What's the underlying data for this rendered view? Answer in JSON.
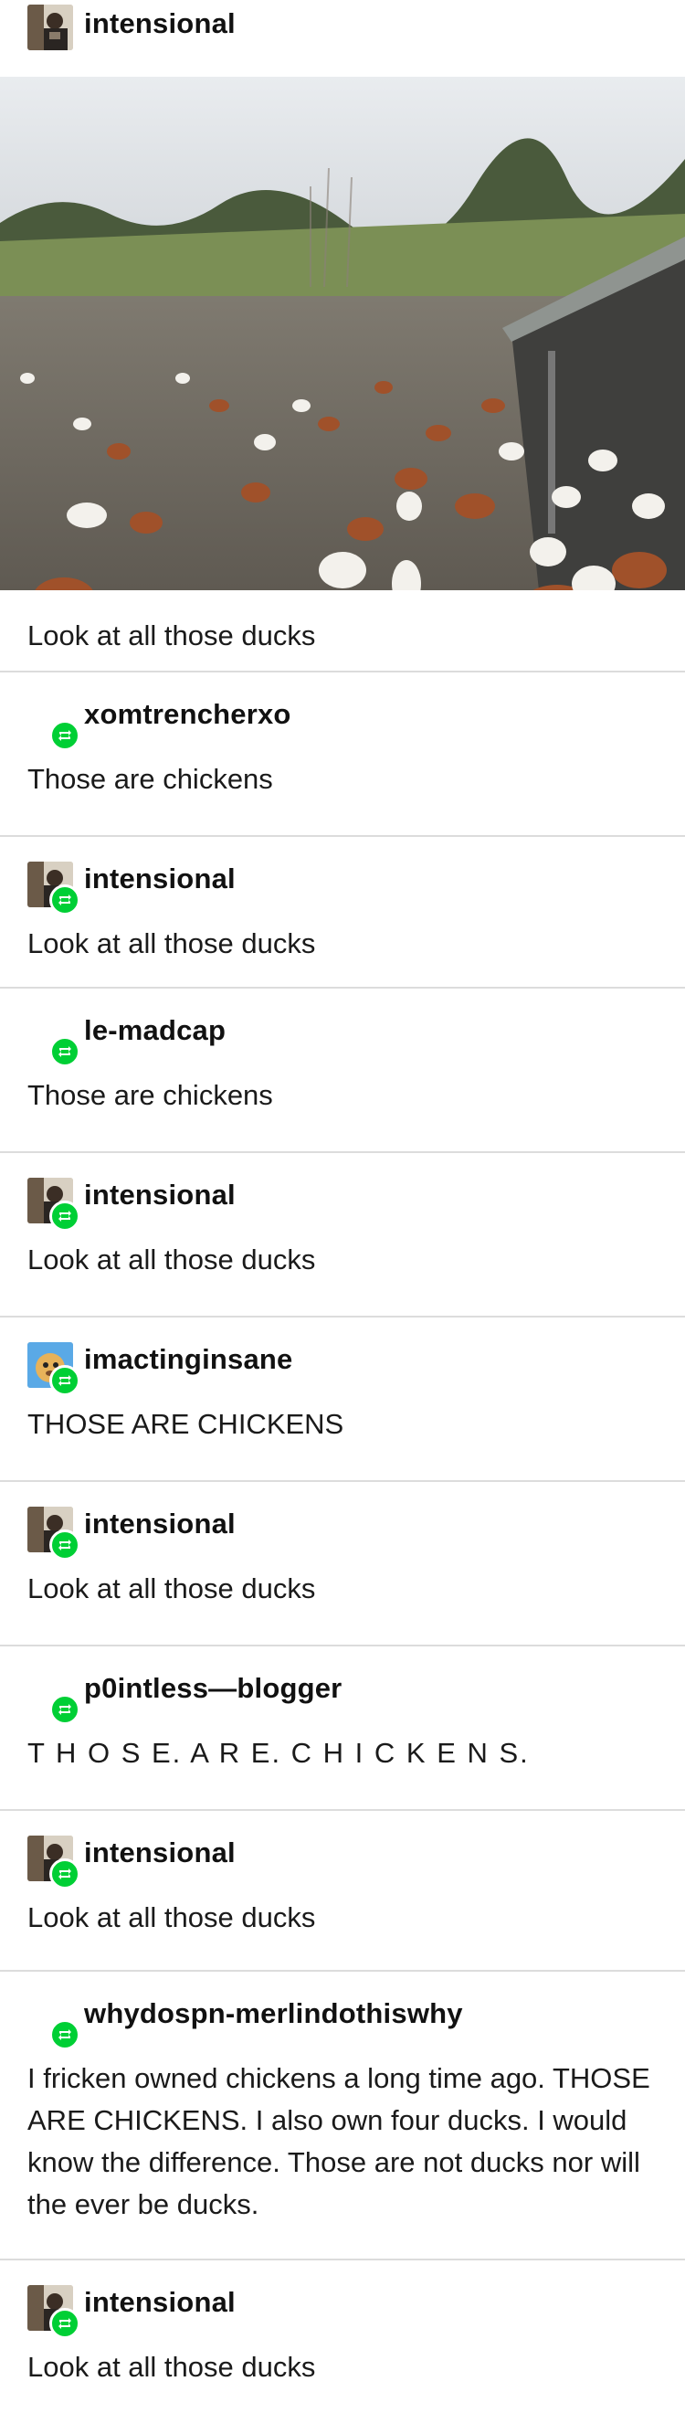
{
  "op": {
    "username": "intensional",
    "caption": "Look at all those ducks"
  },
  "replies": [
    {
      "username": "xomtrencherxo",
      "text": "Those are chickens",
      "avatar": "none"
    },
    {
      "username": "intensional",
      "text": "Look at all those ducks",
      "avatar": "photo"
    },
    {
      "username": "le-madcap",
      "text": "Those are chickens",
      "avatar": "none"
    },
    {
      "username": "intensional",
      "text": "Look at all those ducks",
      "avatar": "photo"
    },
    {
      "username": "imactinginsane",
      "text": "THOSE ARE CHICKENS",
      "avatar": "dog"
    },
    {
      "username": "intensional",
      "text": "Look at all those ducks",
      "avatar": "photo"
    },
    {
      "username": "p0intless—blogger",
      "text": "T H O S E. A R E. C H I C K E N S.",
      "avatar": "none"
    },
    {
      "username": "intensional",
      "text": "Look at all those ducks",
      "avatar": "photo"
    },
    {
      "username": "whydospn-merlindothiswhy",
      "text": "I fricken owned chickens a long time ago. THOSE ARE CHICKENS. I also own four ducks. I would know the difference. Those are not ducks nor will the ever be ducks.",
      "avatar": "none"
    },
    {
      "username": "intensional",
      "text": "Look at all those ducks",
      "avatar": "photo"
    }
  ],
  "icons": {
    "reblog": "reblog-icon",
    "accent": "#00cf35"
  }
}
